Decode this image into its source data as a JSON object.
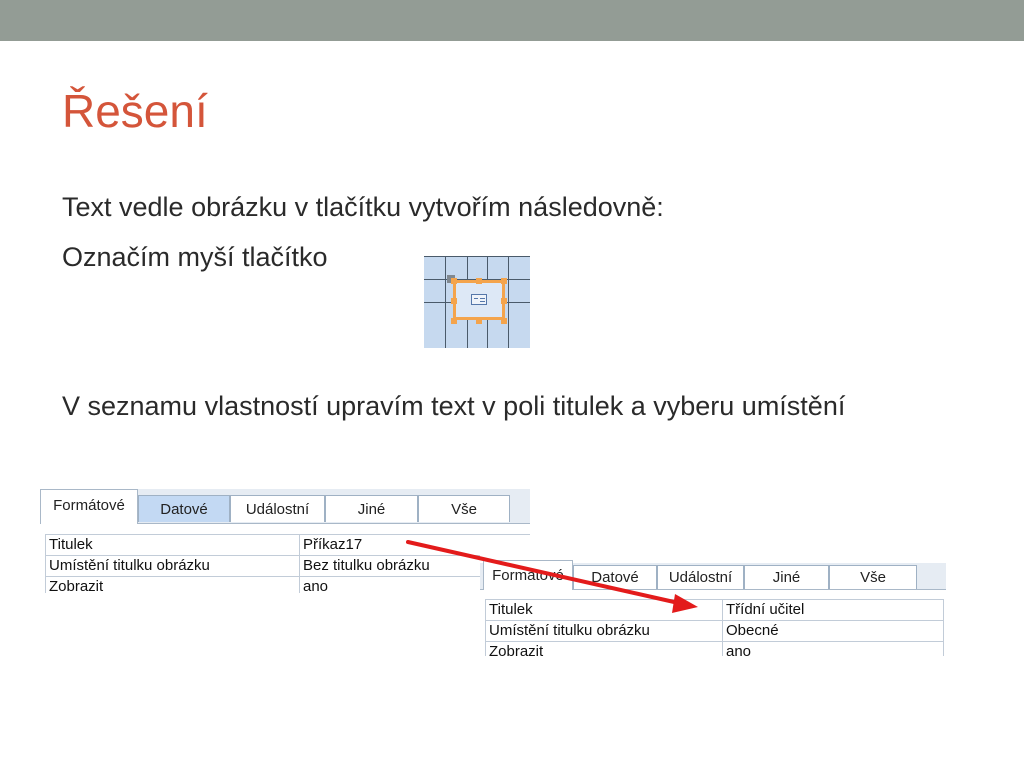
{
  "slide": {
    "title": "Řešení",
    "line1": "Text vedle obrázku v tlačítku vytvořím následovně:",
    "line2": "Označím myší tlačítko",
    "line3": "V seznamu vlastností upravím text v poli titulek a vyberu umístění"
  },
  "panel1": {
    "tabs": [
      "Formátové",
      "Datové",
      "Událostní",
      "Jiné",
      "Vše"
    ],
    "rows": [
      {
        "label": "Titulek",
        "value": "Příkaz17"
      },
      {
        "label": "Umístění titulku obrázku",
        "value": "Bez titulku obrázku"
      },
      {
        "label": "Zobrazit",
        "value": "ano"
      }
    ]
  },
  "panel2": {
    "tabs": [
      "Formátové",
      "Datové",
      "Událostní",
      "Jiné",
      "Vše"
    ],
    "rows": [
      {
        "label": "Titulek",
        "value": "Třídní učitel"
      },
      {
        "label": "Umístění titulku obrázku",
        "value": "Obecné"
      },
      {
        "label": "Zobrazit",
        "value": "ano"
      }
    ]
  },
  "colors": {
    "topbar": "#939c95",
    "title": "#d4553a",
    "arrow": "#e31b1b",
    "selection": "#f4a44c",
    "tab_highlight": "#c3d9f3"
  },
  "icons": {
    "button_preview": "selected-command-button-icon"
  }
}
